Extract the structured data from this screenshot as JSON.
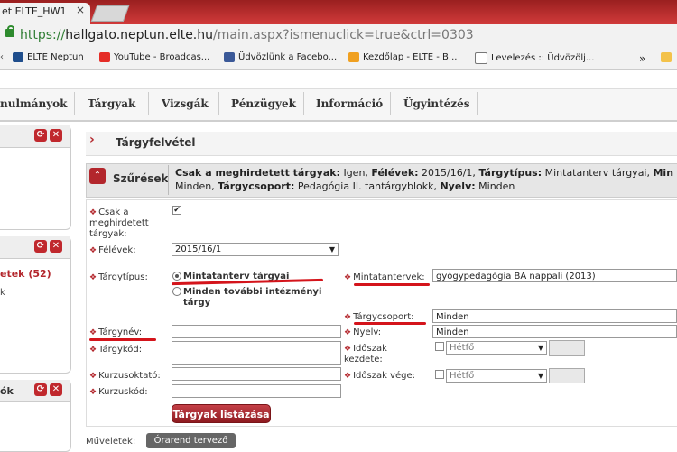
{
  "browser": {
    "tab_title": "et ELTE_HW1",
    "tab_close": "×",
    "url_scheme": "https://",
    "url_host": "hallgato.neptun.elte.hu",
    "url_path": "/main.aspx?ismenuclick=true&ctrl=0303",
    "bookmarks": [
      {
        "label": "ELTE Neptun",
        "icon": "neptun-icon"
      },
      {
        "label": "YouTube - Broadcas...",
        "icon": "youtube-icon"
      },
      {
        "label": "Üdvözlünk a Facebo...",
        "icon": "facebook-icon"
      },
      {
        "label": "Kezdőlap - ELTE - B...",
        "icon": "elte-icon"
      },
      {
        "label": "Levelezés :: Üdvözölj...",
        "icon": "mail-icon"
      }
    ],
    "bookmarks_more": "»"
  },
  "nav": {
    "items": [
      "nulmányok",
      "Tárgyak",
      "Vizsgák",
      "Pénzügyek",
      "Információ",
      "Ügyintézés"
    ]
  },
  "left_panels": {
    "second_text": "etek (52)",
    "second_small": "k",
    "third_text": "ók"
  },
  "breadcrumb": {
    "title": "Tárgyfelvétel"
  },
  "filters": {
    "label": "Szűrések",
    "summary": [
      {
        "key": "Csak a meghirdetett tárgyak:",
        "value": " Igen, "
      },
      {
        "key": "Félévek:",
        "value": " 2015/16/1, "
      },
      {
        "key": "Tárgytípus:",
        "value": " Mintatanterv tárgyai, "
      },
      {
        "key": "Min",
        "value": ""
      },
      {
        "key": "",
        "value": "Minden, "
      },
      {
        "key": "Tárgycsoport:",
        "value": " Pedagógia II. tantárgyblokk, "
      },
      {
        "key": "Nyelv:",
        "value": " Minden"
      }
    ]
  },
  "form": {
    "only_announced_label": "Csak a meghirdetett tárgyak:",
    "only_announced_checked": true,
    "semester_label": "Félévek:",
    "semester_value": "2015/16/1",
    "subject_type_label": "Tárgytípus:",
    "subject_type_opt1": "Mintatanterv tárgyai",
    "subject_type_opt2": "Minden további intézményi tárgy",
    "curriculum_label": "Mintatantervek:",
    "curriculum_value": "gyógypedagógia BA nappali (2013)",
    "subject_group_label": "Tárgycsoport:",
    "subject_group_value": "Minden",
    "subject_name_label": "Tárgynév:",
    "subject_name_value": "",
    "language_label": "Nyelv:",
    "language_value": "Minden",
    "subject_code_label": "Tárgykód:",
    "subject_code_value": "",
    "period_start_label": "Időszak kezdete:",
    "period_start_day": "Hétfő",
    "period_end_label": "Időszak vége:",
    "period_end_day": "Hétfő",
    "instructor_label": "Kurzusoktató:",
    "instructor_value": "",
    "course_code_label": "Kurzuskód:",
    "course_code_value": "",
    "list_button": "Tárgyak listázása"
  },
  "actions": {
    "label": "Műveletek:",
    "timetable_button": "Órarend tervező"
  },
  "colors": {
    "accent": "#b3262c",
    "annotation": "#d4141b"
  }
}
